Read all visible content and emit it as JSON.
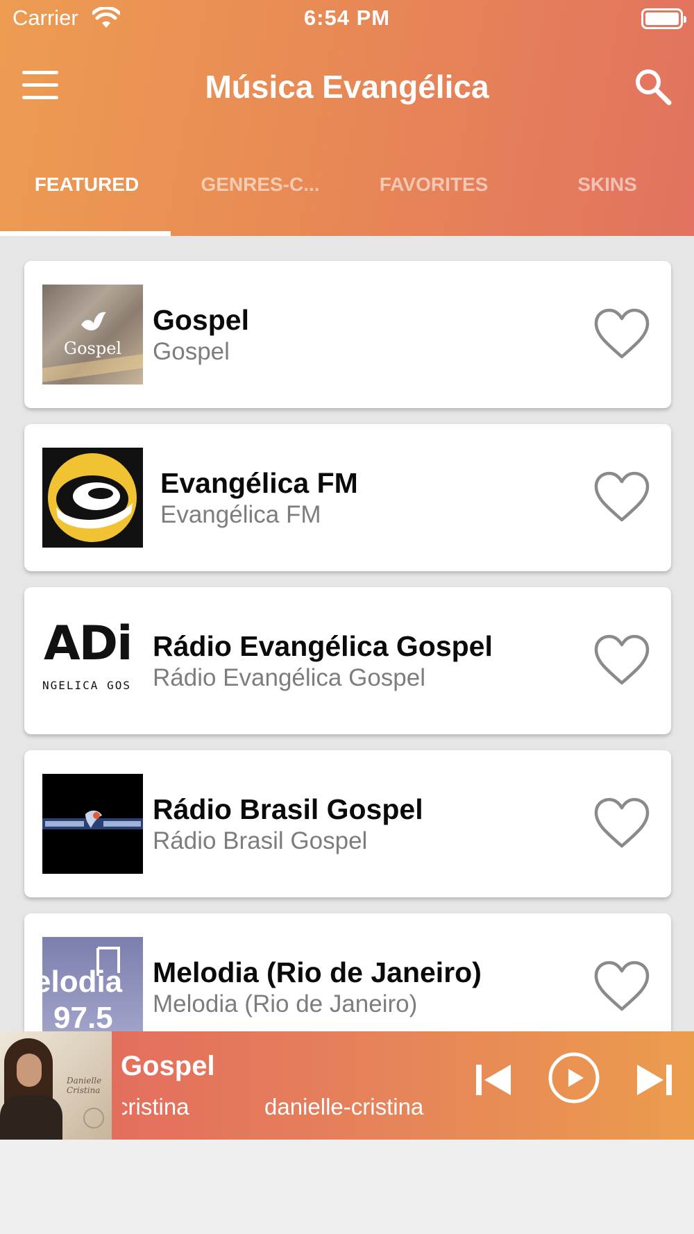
{
  "status_bar": {
    "carrier": "Carrier",
    "time": "6:54 PM"
  },
  "header": {
    "title": "Música Evangélica"
  },
  "tabs": [
    {
      "label": "FEATURED",
      "active": true
    },
    {
      "label": "GENRES-C...",
      "active": false
    },
    {
      "label": "FAVORITES",
      "active": false
    },
    {
      "label": "SKINS",
      "active": false
    }
  ],
  "stations": [
    {
      "title": "Gospel",
      "subtitle": "Gospel",
      "logo_text": "Gospel"
    },
    {
      "title": "Evangélica FM",
      "subtitle": "Evangélica FM"
    },
    {
      "title": "Rádio Evangélica Gospel",
      "subtitle": "Rádio Evangélica Gospel",
      "logo_text": "ADi",
      "logo_subtext": "NGELICA GOS"
    },
    {
      "title": "Rádio Brasil Gospel",
      "subtitle": "Rádio Brasil Gospel"
    },
    {
      "title": "Melodia (Rio de Janeiro)",
      "subtitle": "Melodia (Rio de Janeiro)",
      "logo_text": "elodia",
      "logo_subtext": "97.5"
    }
  ],
  "player": {
    "title": "Gospel",
    "marquee_a": "lle-cristina",
    "marquee_b": "danielle-cristina",
    "cover_signature": "Danielle Cristina"
  },
  "colors": {
    "header_gradient_start": "#ed9c52",
    "header_gradient_end": "#e2725f",
    "player_gradient_start": "#e2655f",
    "player_gradient_end": "#ec9c4d",
    "heart_outline": "#8a8a8a"
  }
}
